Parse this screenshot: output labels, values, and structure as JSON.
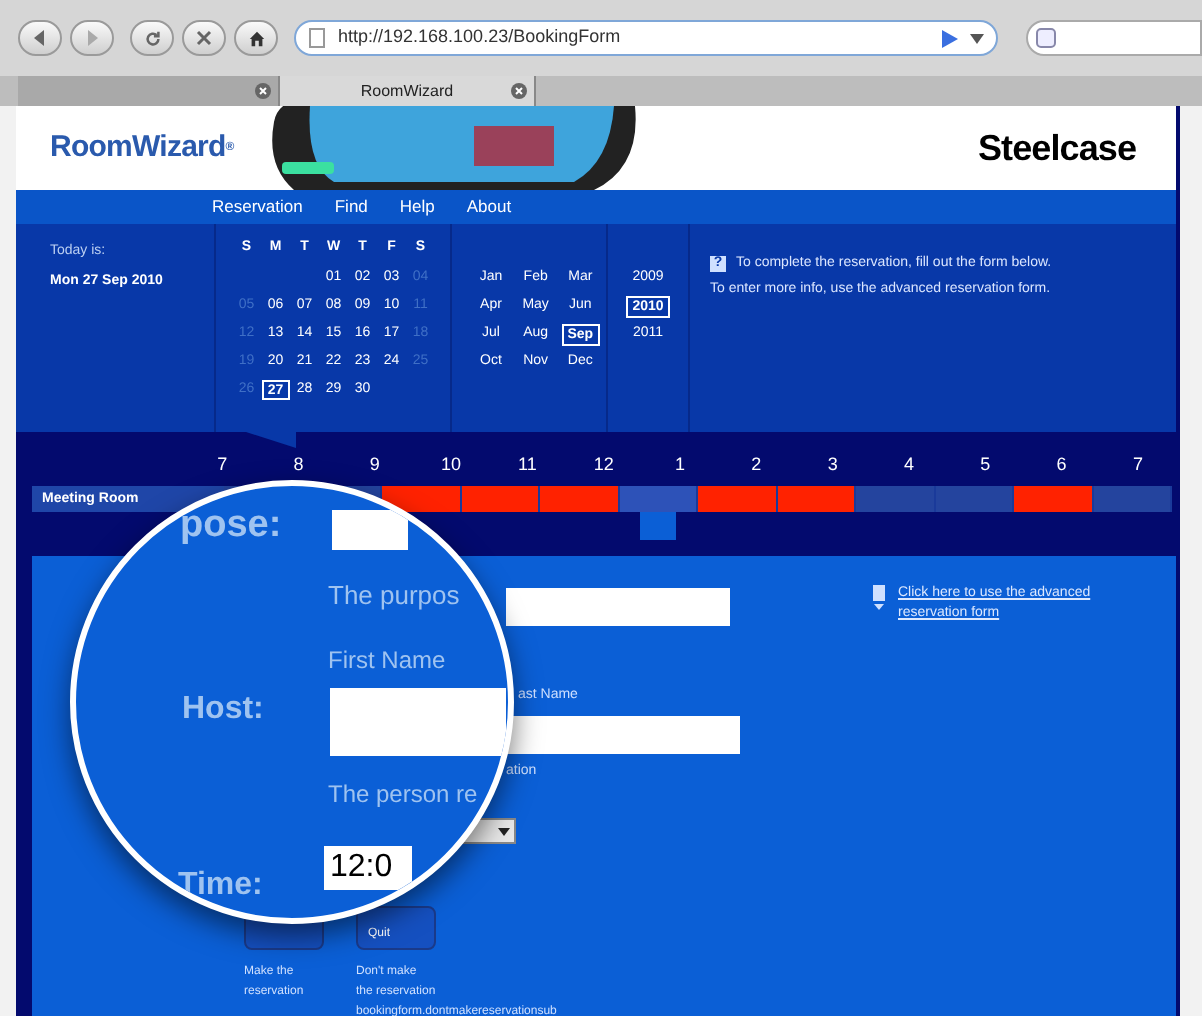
{
  "browser": {
    "url": "http://192.168.100.23/BookingForm",
    "tabs": [
      {
        "selected": false
      },
      {
        "label": "RoomWizard",
        "selected": true
      }
    ]
  },
  "header": {
    "logo": "RoomWizard",
    "logo_mark": "®",
    "brand": "Steelcase"
  },
  "nav": [
    "Reservation",
    "Find",
    "Help",
    "About"
  ],
  "today": {
    "label": "Today is:",
    "date": "Mon 27 Sep 2010"
  },
  "calendar": {
    "weekdays": [
      "S",
      "M",
      "T",
      "W",
      "T",
      "F",
      "S"
    ],
    "weeks": [
      [
        {
          "day": "01",
          "weekend": false,
          "selected": false
        },
        {
          "day": "02",
          "weekend": false,
          "selected": false
        },
        {
          "day": "03",
          "weekend": false,
          "selected": false
        },
        {
          "day": "04",
          "weekend": true,
          "selected": false
        }
      ],
      [
        {
          "day": "05",
          "weekend": true,
          "selected": false
        },
        {
          "day": "06",
          "weekend": false,
          "selected": false
        },
        {
          "day": "07",
          "weekend": false,
          "selected": false
        },
        {
          "day": "08",
          "weekend": false,
          "selected": false
        },
        {
          "day": "09",
          "weekend": false,
          "selected": false
        },
        {
          "day": "10",
          "weekend": false,
          "selected": false
        },
        {
          "day": "11",
          "weekend": true,
          "selected": false
        }
      ],
      [
        {
          "day": "12",
          "weekend": true,
          "selected": false
        },
        {
          "day": "13",
          "weekend": false,
          "selected": false
        },
        {
          "day": "14",
          "weekend": false,
          "selected": false
        },
        {
          "day": "15",
          "weekend": false,
          "selected": false
        },
        {
          "day": "16",
          "weekend": false,
          "selected": false
        },
        {
          "day": "17",
          "weekend": false,
          "selected": false
        },
        {
          "day": "18",
          "weekend": true,
          "selected": false
        }
      ],
      [
        {
          "day": "19",
          "weekend": true,
          "selected": false
        },
        {
          "day": "20",
          "weekend": false,
          "selected": false
        },
        {
          "day": "21",
          "weekend": false,
          "selected": false
        },
        {
          "day": "22",
          "weekend": false,
          "selected": false
        },
        {
          "day": "23",
          "weekend": false,
          "selected": false
        },
        {
          "day": "24",
          "weekend": false,
          "selected": false
        },
        {
          "day": "25",
          "weekend": true,
          "selected": false
        }
      ],
      [
        {
          "day": "26",
          "weekend": true,
          "selected": false
        },
        {
          "day": "27",
          "weekend": false,
          "selected": true
        },
        {
          "day": "28",
          "weekend": false,
          "selected": false
        },
        {
          "day": "29",
          "weekend": false,
          "selected": false
        },
        {
          "day": "30",
          "weekend": false,
          "selected": false
        }
      ]
    ],
    "months": [
      {
        "label": "Jan",
        "selected": false
      },
      {
        "label": "Feb",
        "selected": false
      },
      {
        "label": "Mar",
        "selected": false
      },
      {
        "label": "Apr",
        "selected": false
      },
      {
        "label": "May",
        "selected": false
      },
      {
        "label": "Jun",
        "selected": false
      },
      {
        "label": "Jul",
        "selected": false
      },
      {
        "label": "Aug",
        "selected": false
      },
      {
        "label": "Sep",
        "selected": true
      },
      {
        "label": "Oct",
        "selected": false
      },
      {
        "label": "Nov",
        "selected": false
      },
      {
        "label": "Dec",
        "selected": false
      }
    ],
    "years": [
      {
        "label": "2009",
        "selected": false
      },
      {
        "label": "2010",
        "selected": true
      },
      {
        "label": "2011",
        "selected": false
      }
    ]
  },
  "info": {
    "icon": "?",
    "lines": [
      "To complete the reservation, fill out the form below.",
      "To enter more info, use the advanced reservation form."
    ]
  },
  "timeline": {
    "hours": [
      "7",
      "8",
      "9",
      "10",
      "11",
      "12",
      "1",
      "2",
      "3",
      "4",
      "5",
      "6",
      "7"
    ],
    "room": "Meeting Room",
    "slots": [
      {
        "booked": false,
        "selected": false
      },
      {
        "booked": false,
        "selected": false
      },
      {
        "booked": true,
        "selected": false
      },
      {
        "booked": true,
        "selected": false
      },
      {
        "booked": true,
        "selected": false
      },
      {
        "booked": false,
        "selected": true
      },
      {
        "booked": true,
        "selected": false
      },
      {
        "booked": true,
        "selected": false
      },
      {
        "booked": false,
        "selected": false
      },
      {
        "booked": false,
        "selected": false
      },
      {
        "booked": true,
        "selected": false
      },
      {
        "booked": false,
        "selected": false
      }
    ]
  },
  "form": {
    "last_name_label": "ast Name",
    "host_hint_tail": "ation",
    "advanced_link": "Click here to use the advanced reservation form",
    "buttons": [
      {
        "caption": [
          "Make the",
          "reservation"
        ]
      },
      {
        "label": "Quit",
        "caption": [
          "Don't make",
          "the reservation",
          "bookingform.dontmakereservationsub"
        ]
      }
    ]
  },
  "magnifier": {
    "purpose_label": "pose:",
    "purpose_hint": "The purpos",
    "first_name_label": "First Name",
    "host_label": "Host:",
    "host_hint": "The person re",
    "time_label": "Time:",
    "time_value": "12:0"
  }
}
